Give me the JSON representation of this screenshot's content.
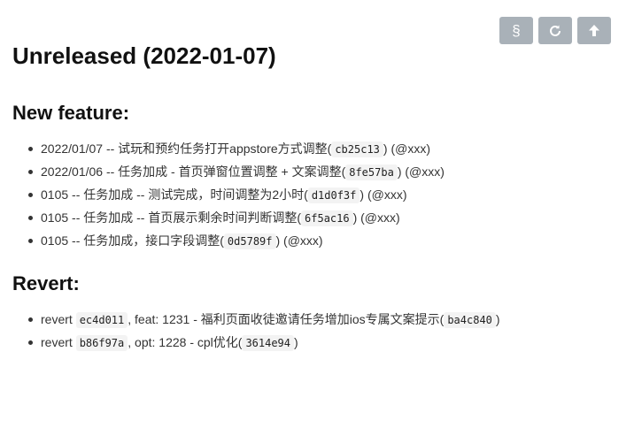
{
  "toolbar": {
    "section_glyph": "§",
    "buttons": [
      "section-icon",
      "refresh-icon",
      "upload-icon"
    ]
  },
  "title": "Unreleased (2022-01-07)",
  "new_feature": {
    "heading": "New feature:",
    "items": [
      {
        "text": "2022/01/07 -- 试玩和预约任务打开appstore方式调整(",
        "hash": "cb25c13",
        "suffix": ") (@xxx)"
      },
      {
        "text": "2022/01/06 -- 任务加成 - 首页弹窗位置调整 + 文案调整(",
        "hash": "8fe57ba",
        "suffix": ") (@xxx)"
      },
      {
        "text": "0105 -- 任务加成 -- 测试完成，时间调整为2小时(",
        "hash": "d1d0f3f",
        "suffix": ") (@xxx)"
      },
      {
        "text": "0105 -- 任务加成 -- 首页展示剩余时间判断调整(",
        "hash": "6f5ac16",
        "suffix": ") (@xxx)"
      },
      {
        "text": "0105 -- 任务加成，接口字段调整(",
        "hash": "0d5789f",
        "suffix": ") (@xxx)"
      }
    ]
  },
  "revert": {
    "heading": "Revert:",
    "items": [
      {
        "prefix": "revert ",
        "hash1": "ec4d011",
        "text": ", feat: 1231 - 福利页面收徒邀请任务增加ios专属文案提示(",
        "hash2": "ba4c840",
        "suffix": ")"
      },
      {
        "prefix": "revert ",
        "hash1": "b86f97a",
        "text": ", opt: 1228 - cpl优化(",
        "hash2": "3614e94",
        "suffix": ")"
      }
    ]
  }
}
